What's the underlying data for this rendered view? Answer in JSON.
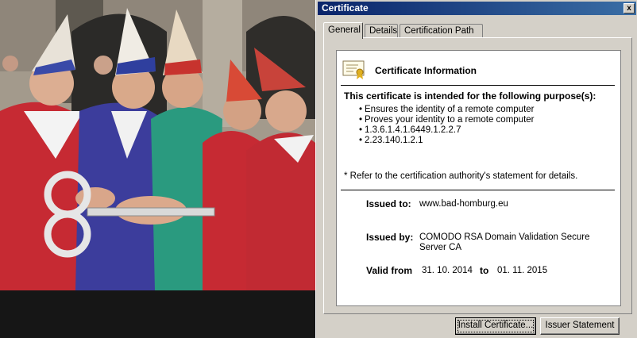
{
  "window": {
    "title": "Certificate",
    "close_label": "x"
  },
  "tabs": [
    {
      "label": "General",
      "active": true
    },
    {
      "label": "Details",
      "active": false
    },
    {
      "label": "Certification Path",
      "active": false
    }
  ],
  "info": {
    "title": "Certificate Information",
    "purpose_heading": "This certificate is intended for the following purpose(s):",
    "purposes": [
      "Ensures the identity of a remote computer",
      "Proves your identity to a remote computer",
      "1.3.6.1.4.1.6449.1.2.2.7",
      "2.23.140.1.2.1"
    ],
    "note": "* Refer to the certification authority's statement for details.",
    "issued_to_label": "Issued to:",
    "issued_to": "www.bad-homburg.eu",
    "issued_by_label": "Issued by:",
    "issued_by": "COMODO RSA Domain Validation Secure Server CA",
    "valid_from_label": "Valid from",
    "valid_from": "31. 10. 2014",
    "to_label": "to",
    "valid_to": "01. 11. 2015"
  },
  "buttons": {
    "install": "Install Certificate...",
    "issuer": "Issuer Statement"
  },
  "colors": {
    "titlebar_start": "#0a246a",
    "titlebar_end": "#3a6ea5",
    "dialog_face": "#d4d0c8"
  },
  "icons": [
    "certificate-icon",
    "close-icon"
  ]
}
